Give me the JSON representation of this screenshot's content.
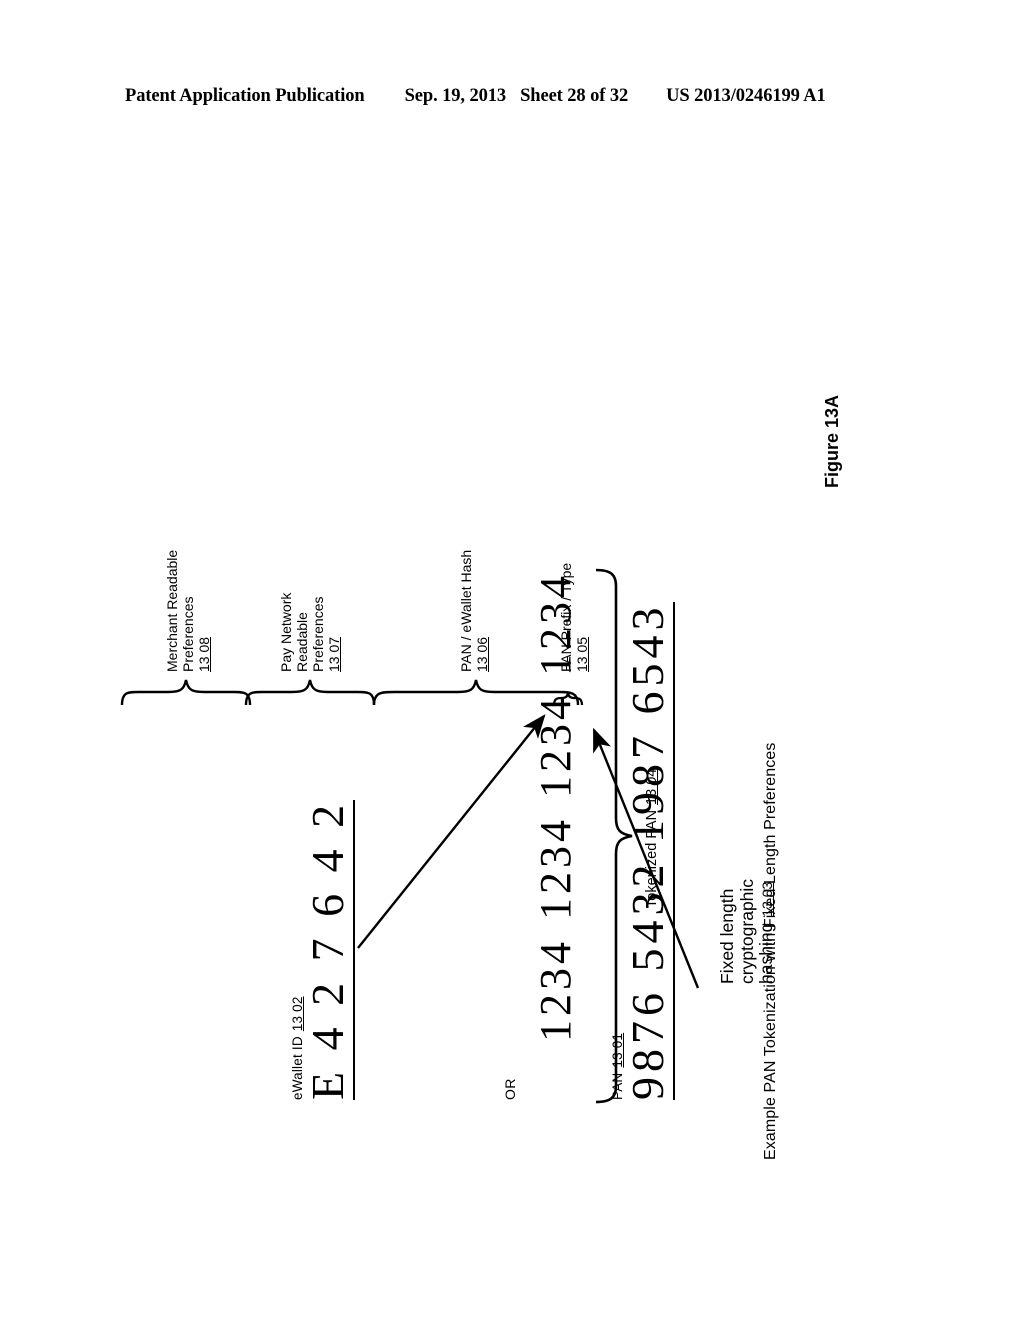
{
  "header": {
    "publication": "Patent Application Publication",
    "date": "Sep. 19, 2013",
    "sheet": "Sheet 28 of 32",
    "patent_number": "US 2013/0246199 A1"
  },
  "figure": {
    "caption": "Example PAN Tokenization with Fixed Length Preferences",
    "number": "Figure 13A"
  },
  "sources": {
    "pan": {
      "label": "PAN",
      "ref": "13 01",
      "digits": "9876 5432 1987 6543"
    },
    "or_text": "OR",
    "ewallet": {
      "label": "eWallet ID",
      "ref": "13 02",
      "digits": "E 4 2 7 6 4 2"
    }
  },
  "process": {
    "line1": "Fixed length",
    "line2": "cryptographic",
    "line3": "hashing",
    "ref": "13 03"
  },
  "token": {
    "overall_label": "Tokenized PAN",
    "overall_ref": "13 04",
    "groups": [
      "1234",
      "1234",
      "1234",
      "1234"
    ],
    "segments": [
      {
        "ref": "13 05",
        "line1": "PAN Prefix / Type",
        "line2": "",
        "line3": ""
      },
      {
        "ref": "13 06",
        "line1": "PAN / eWallet Hash",
        "line2": "",
        "line3": ""
      },
      {
        "ref": "13 07",
        "line1": "Pay Network",
        "line2": "Readable",
        "line3": "Preferences"
      },
      {
        "ref": "13 08",
        "line1": "Merchant Readable",
        "line2": "Preferences",
        "line3": ""
      }
    ]
  },
  "colors": {
    "ink": "#000000",
    "paper": "#ffffff"
  }
}
